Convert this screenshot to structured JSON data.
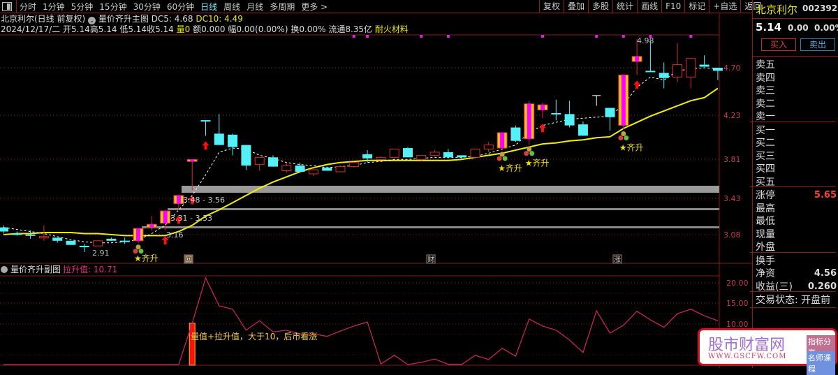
{
  "toolbar": {
    "periods": [
      "分时",
      "1分钟",
      "5分钟",
      "15分钟",
      "30分钟",
      "60分钟",
      "日线",
      "周线",
      "月线",
      "多周期",
      "更多 >"
    ],
    "active": "日线",
    "right": [
      "复权",
      "叠加",
      "多股",
      "统计",
      "画线",
      "F10",
      "标记",
      "+自选",
      "返回"
    ]
  },
  "header": {
    "title": "北京利尔(日线 前复权)",
    "indicator": "量价齐升主图",
    "dc5_label": "DC5: 4.68",
    "dc10_label": "DC10: 4.49",
    "date": "2024/12/17/二",
    "open": "开5.14",
    "high": "高5.14",
    "low": "低5.14",
    "close": "收5.14",
    "vol_label": "量",
    "vol": "0",
    "amount": "额0.000",
    "range": "幅0.00(0.00%)",
    "turnover": "换0.00%",
    "float": "流通8.35亿",
    "sector": "耐火材料"
  },
  "colors": {
    "up": "#d03030",
    "down": "#54f0f8",
    "limit": "#ff00ff",
    "ma10": "#f0f000",
    "ma5": "#ffffff",
    "grid": "#8b1a1a",
    "sub": "#c0285a"
  },
  "price_axis": [
    "4.70",
    "4.23",
    "3.81",
    "3.43",
    "3.08"
  ],
  "sub_axis": [
    "20.00",
    "15.00",
    "10.00"
  ],
  "annotations": {
    "low": "2.91",
    "high": "4.98",
    "band1": "3.48 - 3.56",
    "band2": "3.31 - 3.33",
    "band3": "3.16",
    "signal": "★齐升",
    "events": [
      "回",
      "财",
      "涨"
    ]
  },
  "chart_data": {
    "type": "candlestick",
    "candles": [
      [
        "d",
        3.15,
        3.17,
        3.09,
        3.11
      ],
      [
        "d",
        3.09,
        3.11,
        3.07,
        3.09
      ],
      [
        "d",
        3.081,
        3.12,
        3.04,
        3.08
      ],
      [
        "u",
        3.06,
        3.17,
        3.02,
        3.061
      ],
      [
        "d",
        3.05,
        3.05,
        3.0,
        3.02
      ],
      [
        "d",
        3.02,
        3.02,
        2.98,
        2.98
      ],
      [
        "d",
        2.971,
        2.99,
        2.91,
        2.97
      ],
      [
        "u",
        2.97,
        3.02,
        2.97,
        3.02
      ],
      [
        "d",
        3.04,
        3.05,
        3.02,
        3.02
      ],
      [
        "d",
        3.021,
        3.05,
        2.99,
        3.02
      ],
      [
        "l",
        3.02,
        3.14,
        3.0,
        3.14
      ],
      [
        "l",
        3.15,
        3.26,
        3.12,
        3.18
      ],
      [
        "l",
        3.19,
        3.32,
        3.12,
        3.31
      ],
      [
        "l",
        3.38,
        3.47,
        3.32,
        3.46
      ],
      [
        "l",
        3.79,
        3.81,
        3.51,
        3.81
      ],
      [
        "d",
        4.191,
        4.19,
        4.04,
        4.19
      ],
      [
        "d",
        4.06,
        4.25,
        3.95,
        3.95
      ],
      [
        "d",
        4.05,
        4.06,
        3.85,
        3.93
      ],
      [
        "d",
        3.95,
        3.95,
        3.71,
        3.75
      ],
      [
        "u",
        3.76,
        3.83,
        3.7,
        3.83
      ],
      [
        "d",
        3.83,
        3.85,
        3.74,
        3.74
      ],
      [
        "u",
        3.7,
        3.78,
        3.68,
        3.75
      ],
      [
        "d",
        3.75,
        3.78,
        3.69,
        3.69
      ],
      [
        "u",
        3.67,
        3.73,
        3.65,
        3.71
      ],
      [
        "d",
        3.73,
        3.74,
        3.7,
        3.7
      ],
      [
        "u",
        3.69,
        3.75,
        3.69,
        3.74
      ],
      [
        "u",
        3.74,
        3.78,
        3.73,
        3.78
      ],
      [
        "d",
        3.86,
        3.9,
        3.78,
        3.82
      ],
      [
        "u",
        3.81,
        3.84,
        3.8,
        3.83
      ],
      [
        "u",
        3.83,
        3.91,
        3.82,
        3.91
      ],
      [
        "d",
        3.92,
        3.93,
        3.83,
        3.83
      ],
      [
        "u",
        3.81,
        3.85,
        3.8,
        3.85
      ],
      [
        "u",
        3.85,
        3.9,
        3.84,
        3.88
      ],
      [
        "d",
        3.88,
        3.91,
        3.82,
        3.83
      ],
      [
        "d",
        3.85,
        3.85,
        3.81,
        3.83
      ],
      [
        "u",
        3.83,
        3.91,
        3.83,
        3.91
      ],
      [
        "u",
        3.91,
        3.98,
        3.88,
        3.95
      ],
      [
        "l",
        3.92,
        4.07,
        3.9,
        4.07
      ],
      [
        "d",
        4.12,
        4.14,
        3.98,
        3.99
      ],
      [
        "l",
        4.01,
        4.38,
        3.95,
        4.35
      ],
      [
        "l",
        4.29,
        4.36,
        4.21,
        4.34
      ],
      [
        "d",
        4.26,
        4.39,
        4.19,
        4.25
      ],
      [
        "d",
        4.25,
        4.38,
        4.12,
        4.14
      ],
      [
        "d",
        4.15,
        4.18,
        4.04,
        4.04
      ],
      [
        "w",
        4.43,
        4.43,
        4.33,
        4.43
      ],
      [
        "d",
        4.31,
        4.31,
        4.09,
        4.22
      ],
      [
        "l",
        4.14,
        4.63,
        4.1,
        4.63
      ],
      [
        "l",
        4.76,
        4.98,
        4.63,
        4.81
      ],
      [
        "d",
        4.67,
        4.96,
        4.66,
        4.66
      ],
      [
        "d",
        4.65,
        4.75,
        4.5,
        4.6
      ],
      [
        "u",
        4.61,
        4.94,
        4.56,
        4.73
      ],
      [
        "u",
        4.61,
        4.79,
        4.5,
        4.79
      ],
      [
        "d",
        4.73,
        4.82,
        4.71,
        4.71
      ],
      [
        "d",
        4.7,
        4.7,
        4.58,
        4.67
      ]
    ],
    "candle_fields": [
      "type",
      "open",
      "high",
      "low",
      "close"
    ],
    "ma10": [
      3.08,
      3.09,
      3.09,
      3.1,
      3.1,
      3.1,
      3.09,
      3.09,
      3.08,
      3.07,
      3.07,
      3.07,
      3.07,
      3.11,
      3.17,
      3.26,
      3.32,
      3.39,
      3.46,
      3.53,
      3.59,
      3.64,
      3.69,
      3.73,
      3.76,
      3.78,
      3.79,
      3.8,
      3.8,
      3.8,
      3.8,
      3.8,
      3.8,
      3.8,
      3.81,
      3.83,
      3.85,
      3.87,
      3.9,
      3.93,
      3.96,
      3.97,
      3.99,
      4.0,
      4.02,
      4.03,
      4.11,
      4.17,
      4.23,
      4.28,
      4.33,
      4.38,
      4.41,
      4.5
    ],
    "ma5": [
      3.15,
      3.13,
      3.11,
      3.09,
      3.06,
      3.03,
      3.01,
      3.0,
      3.0,
      3.01,
      3.03,
      3.09,
      3.17,
      3.32,
      3.46,
      3.66,
      3.88,
      3.92,
      3.91,
      3.85,
      3.82,
      3.78,
      3.76,
      3.75,
      3.73,
      3.74,
      3.75,
      3.78,
      3.79,
      3.81,
      3.81,
      3.82,
      3.83,
      3.83,
      3.83,
      3.84,
      3.87,
      3.91,
      3.95,
      4.07,
      4.14,
      4.17,
      4.2,
      4.21,
      4.22,
      4.23,
      4.34,
      4.51,
      4.61,
      4.58,
      4.67,
      4.69,
      4.7,
      4.69
    ],
    "up_arrows": [
      12,
      13,
      14,
      15,
      40,
      47
    ],
    "signals": [
      10,
      37,
      39,
      46
    ],
    "top_dots": [
      26,
      27,
      31,
      33,
      40,
      44,
      46,
      48,
      51
    ],
    "bands": [
      [
        3.48,
        3.56
      ],
      [
        3.31,
        3.33
      ],
      [
        3.16,
        3.16
      ]
    ],
    "sub": {
      "title": "量价齐升副图",
      "series_label": "拉升值: 10.71",
      "note": "量值+拉升值，大于10，后市看涨",
      "values": [
        0,
        0,
        0,
        0,
        0,
        0,
        0,
        0,
        0,
        0,
        0,
        0,
        0,
        0,
        10.2,
        21.2,
        14.4,
        13.6,
        8.5,
        10.8,
        8.1,
        8.5,
        7.6,
        7.6,
        7.0,
        8.3,
        9.5,
        10.5,
        0.3,
        2.4,
        0,
        0.7,
        1.5,
        0.2,
        0.2,
        2.4,
        1.4,
        4.1,
        2.2,
        11.2,
        9.5,
        8.5,
        6.1,
        3.1,
        13.2,
        7.8,
        9.7,
        13.1,
        11.0,
        9.2,
        12.5,
        13.6,
        12.0,
        10.8
      ],
      "bar_index": 14,
      "ylim": [
        0,
        22
      ]
    }
  },
  "panel": {
    "name": "北京利尔",
    "code": "002392",
    "price": "5.14",
    "chg": "0.00",
    "pct": "0.00%",
    "buy": "买入",
    "sell": "卖出",
    "asks": [
      "卖五",
      "卖四",
      "卖三",
      "卖二",
      "卖一"
    ],
    "bids": [
      "买一",
      "买二",
      "买三",
      "买四",
      "买五"
    ],
    "stats": [
      {
        "k": "涨停",
        "v": "5.65"
      },
      {
        "k": "最高",
        "v": ""
      },
      {
        "k": "最低",
        "v": ""
      },
      {
        "k": "现量",
        "v": ""
      },
      {
        "k": "外盘",
        "v": ""
      }
    ],
    "stats2": [
      {
        "k": "换手",
        "v": ""
      },
      {
        "k": "净资",
        "v": "4.56"
      },
      {
        "k": "收益(三)",
        "v": "0.260"
      }
    ],
    "status": "交易状态: 开盘前"
  },
  "watermark": {
    "name": "股市财富网",
    "url": "WWW.GSCFW.COM",
    "tag1": "指标分享",
    "tag2": "名师课程"
  }
}
